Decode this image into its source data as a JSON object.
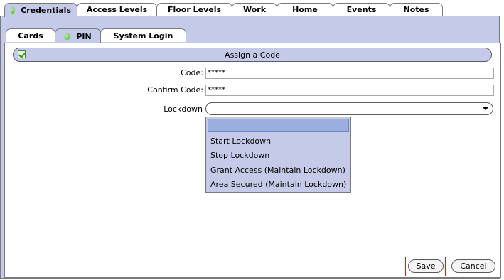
{
  "top_tabs": [
    {
      "label": "Credentials",
      "active": true
    },
    {
      "label": "Access Levels"
    },
    {
      "label": "Floor Levels"
    },
    {
      "label": "Work"
    },
    {
      "label": "Home"
    },
    {
      "label": "Events"
    },
    {
      "label": "Notes"
    }
  ],
  "sub_tabs": [
    {
      "label": "Cards"
    },
    {
      "label": "PIN",
      "active": true
    },
    {
      "label": "System Login"
    }
  ],
  "section": {
    "title": "Assign a Code"
  },
  "form": {
    "code_label": "Code:",
    "code_value": "*****",
    "confirm_label": "Confirm Code:",
    "confirm_value": "*****",
    "lockdown_label": "Lockdown",
    "lockdown_value": ""
  },
  "lockdown_options": [
    "",
    "Start Lockdown",
    "Stop Lockdown",
    "Grant Access (Maintain Lockdown)",
    "Area Secured (Maintain Lockdown)"
  ],
  "buttons": {
    "save": "Save",
    "cancel": "Cancel"
  },
  "colors": {
    "panel": "#c5cae8",
    "selected_option": "#9aaee0",
    "highlight": "#cc2222"
  }
}
